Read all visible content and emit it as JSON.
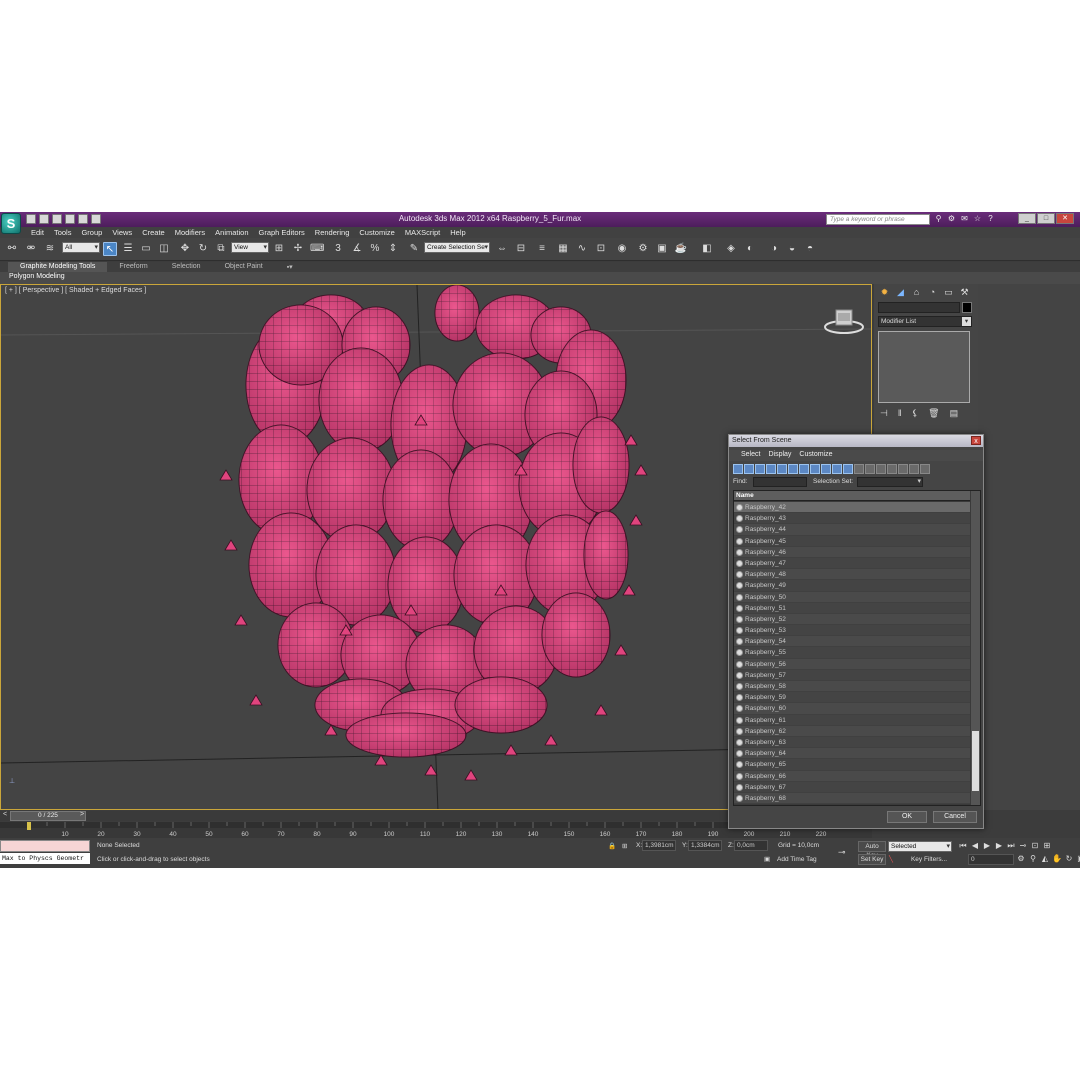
{
  "window": {
    "app_logo": "S",
    "title": "Autodesk 3ds Max  2012 x64      Raspberry_5_Fur.max",
    "search_placeholder": "Type a keyword or phrase"
  },
  "menu": [
    "Edit",
    "Tools",
    "Group",
    "Views",
    "Create",
    "Modifiers",
    "Animation",
    "Graph Editors",
    "Rendering",
    "Customize",
    "MAXScript",
    "Help"
  ],
  "toolbar": {
    "filter_value": "All",
    "refcoord_value": "View",
    "selection_set_value": "Create Selection Se"
  },
  "ribbon": {
    "tabs": [
      "Graphite Modeling Tools",
      "Freeform",
      "Selection",
      "Object Paint"
    ],
    "panel_label": "Polygon Modeling"
  },
  "viewport": {
    "label": "[ + ] [ Perspective ] [ Shaded + Edged Faces ]",
    "object_color": "#e0447e",
    "wire_color": "#1a1a1a"
  },
  "command_panel": {
    "modifier_list": "Modifier List"
  },
  "dialog": {
    "title": "Select From Scene",
    "close": "x",
    "menu": [
      "Select",
      "Display",
      "Customize"
    ],
    "find_label": "Find:",
    "selection_set_label": "Selection Set:",
    "column_name": "Name",
    "rows": [
      "Raspberry_42",
      "Raspberry_43",
      "Raspberry_44",
      "Raspberry_45",
      "Raspberry_46",
      "Raspberry_47",
      "Raspberry_48",
      "Raspberry_49",
      "Raspberry_50",
      "Raspberry_51",
      "Raspberry_52",
      "Raspberry_53",
      "Raspberry_54",
      "Raspberry_55",
      "Raspberry_56",
      "Raspberry_57",
      "Raspberry_58",
      "Raspberry_59",
      "Raspberry_60",
      "Raspberry_61",
      "Raspberry_62",
      "Raspberry_63",
      "Raspberry_64",
      "Raspberry_65",
      "Raspberry_66",
      "Raspberry_67",
      "Raspberry_68"
    ],
    "ok": "OK",
    "cancel": "Cancel"
  },
  "timeline": {
    "frame_indicator": "0 / 225",
    "prev": "<",
    "next": ">",
    "ticks": [
      "0",
      "10",
      "20",
      "30",
      "40",
      "50",
      "60",
      "70",
      "80",
      "90",
      "100",
      "110",
      "120",
      "130",
      "140",
      "150",
      "160",
      "170",
      "180",
      "190",
      "200",
      "210",
      "220"
    ]
  },
  "status": {
    "maxscript_text": "Max to Physcs Geometr",
    "selection_status": "None Selected",
    "prompt": "Click or click-and-drag to select objects",
    "x_label": "X:",
    "x_value": "1,3981cm",
    "y_label": "Y:",
    "y_value": "1,3384cm",
    "z_label": "Z:",
    "z_value": "0,0cm",
    "grid": "Grid = 10,0cm",
    "add_time_tag": "Add Time Tag",
    "auto_key": "Auto Key",
    "set_key": "Set Key",
    "key_mode_value": "Selected",
    "key_filters": "Key Filters...",
    "frame_value": "0"
  }
}
